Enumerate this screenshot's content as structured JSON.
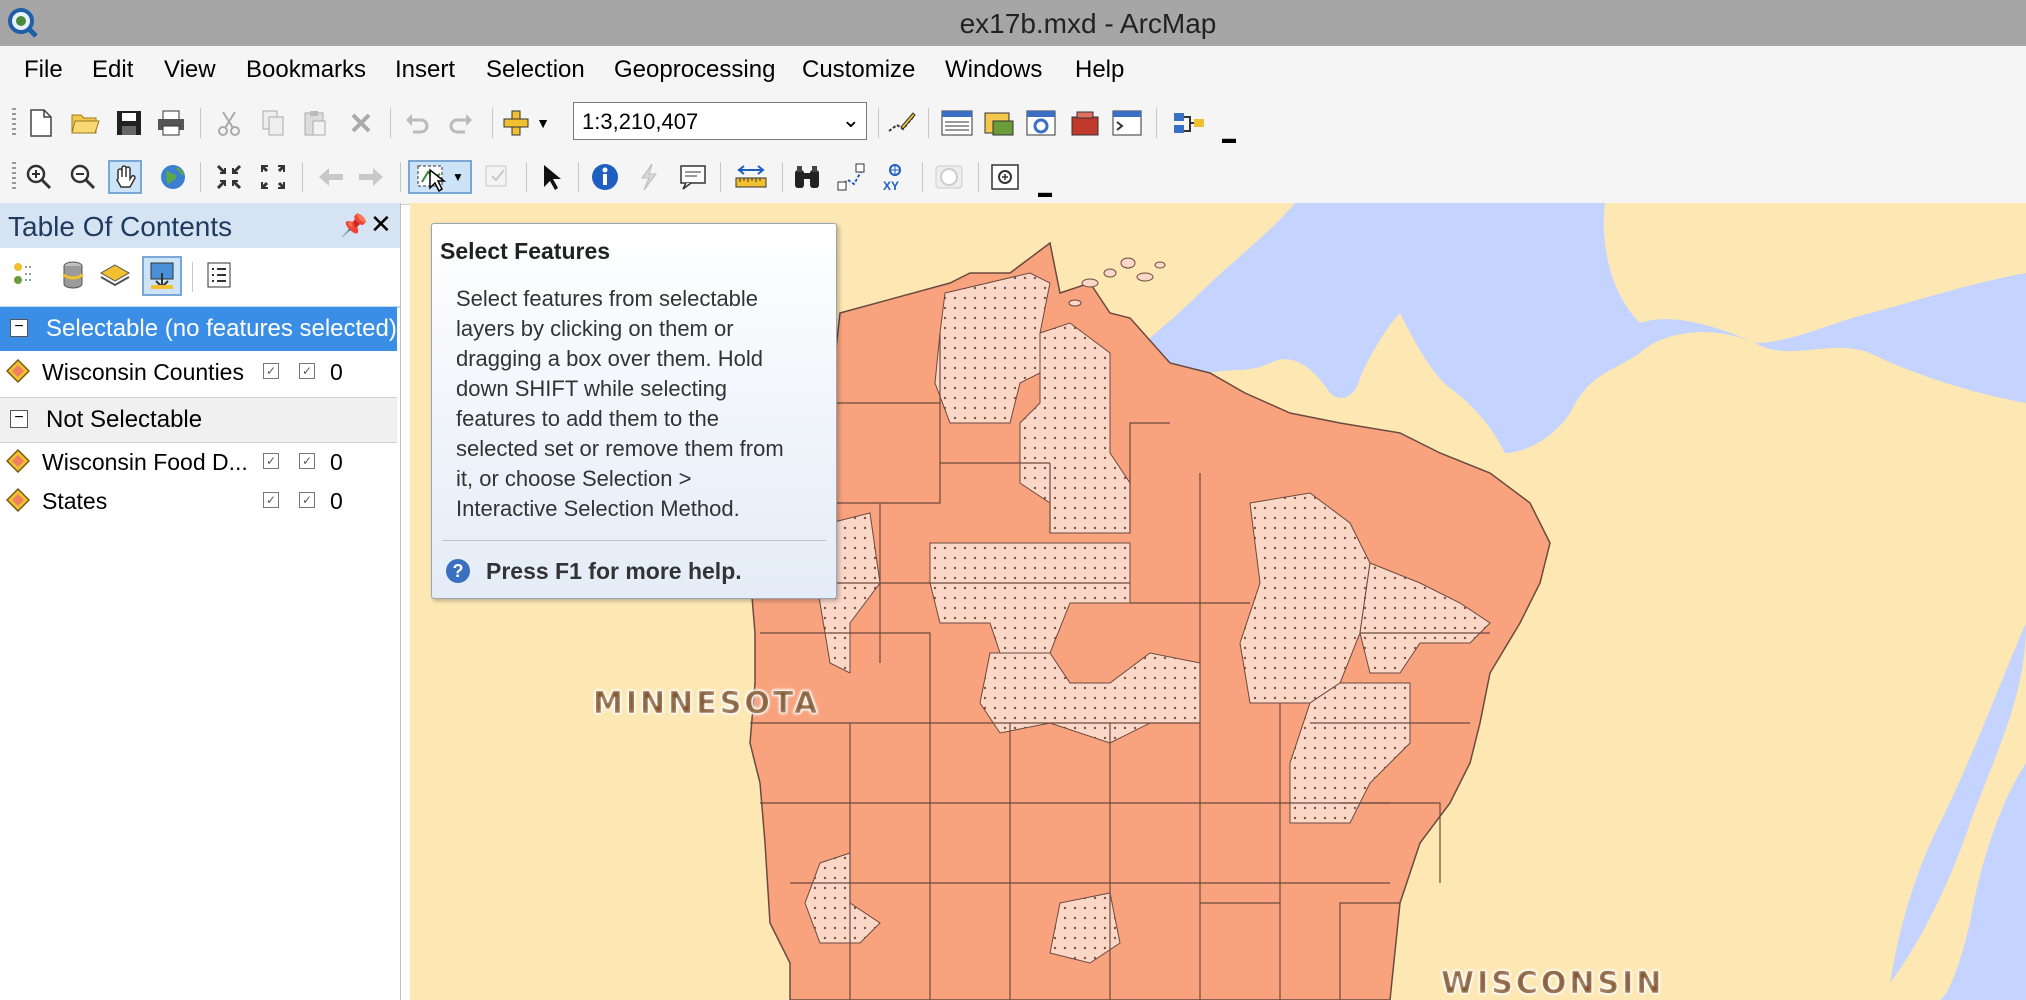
{
  "window": {
    "title": "ex17b.mxd - ArcMap"
  },
  "menubar": {
    "items": [
      "File",
      "Edit",
      "View",
      "Bookmarks",
      "Insert",
      "Selection",
      "Geoprocessing",
      "Customize",
      "Windows",
      "Help"
    ]
  },
  "standard_toolbar": {
    "scale_value": "1:3,210,407",
    "icons": [
      "new-document",
      "open",
      "save",
      "print",
      "cut",
      "copy",
      "paste",
      "delete",
      "undo",
      "redo",
      "add-data",
      "editor-toolbar",
      "catalog",
      "search",
      "arctoolbox",
      "python",
      "model-builder"
    ]
  },
  "tools_toolbar": {
    "icons": [
      "zoom-in",
      "zoom-out",
      "pan",
      "full-extent",
      "fixed-zoom-in",
      "fixed-zoom-out",
      "go-back",
      "go-forward",
      "select-features",
      "clear-selection",
      "select-elements",
      "identify",
      "hyperlink",
      "html-popup",
      "measure",
      "find",
      "find-route",
      "go-to-xy",
      "time-slider",
      "create-viewer-window"
    ],
    "active_tool": "select-features"
  },
  "toc": {
    "title": "Table Of Contents",
    "groups": [
      {
        "label": "Selectable (no features selected)",
        "selected": true,
        "layers": [
          {
            "name": "Wisconsin Counties",
            "count": "0"
          }
        ]
      },
      {
        "label": "Not Selectable",
        "selected": false,
        "layers": [
          {
            "name": "Wisconsin Food D...",
            "count": "0"
          },
          {
            "name": "States",
            "count": "0"
          }
        ]
      }
    ]
  },
  "tooltip": {
    "title": "Select Features",
    "body": "Select features from selectable layers by clicking on them or dragging a box over them. Hold down SHIFT while selecting features to add them to the selected set or remove them from it, or choose Selection > Interactive Selection Method.",
    "body_lines": [
      "Select features from selectable",
      "layers by clicking on them or",
      "dragging a box over them. Hold",
      "down SHIFT while selecting",
      "features to add them to the",
      "selected set or remove them from",
      "it, or choose Selection >",
      "Interactive Selection Method."
    ],
    "help": "Press F1 for more help."
  },
  "map": {
    "labels": {
      "minnesota": "MINNESOTA",
      "wisconsin": "WISCONSIN"
    },
    "colors": {
      "land": "#fde8b3",
      "water": "#c4d3ff",
      "county_fill": "#f8a27e",
      "food_desert_fill": "#fbd7c8",
      "county_border": "#6b4a3f"
    }
  }
}
